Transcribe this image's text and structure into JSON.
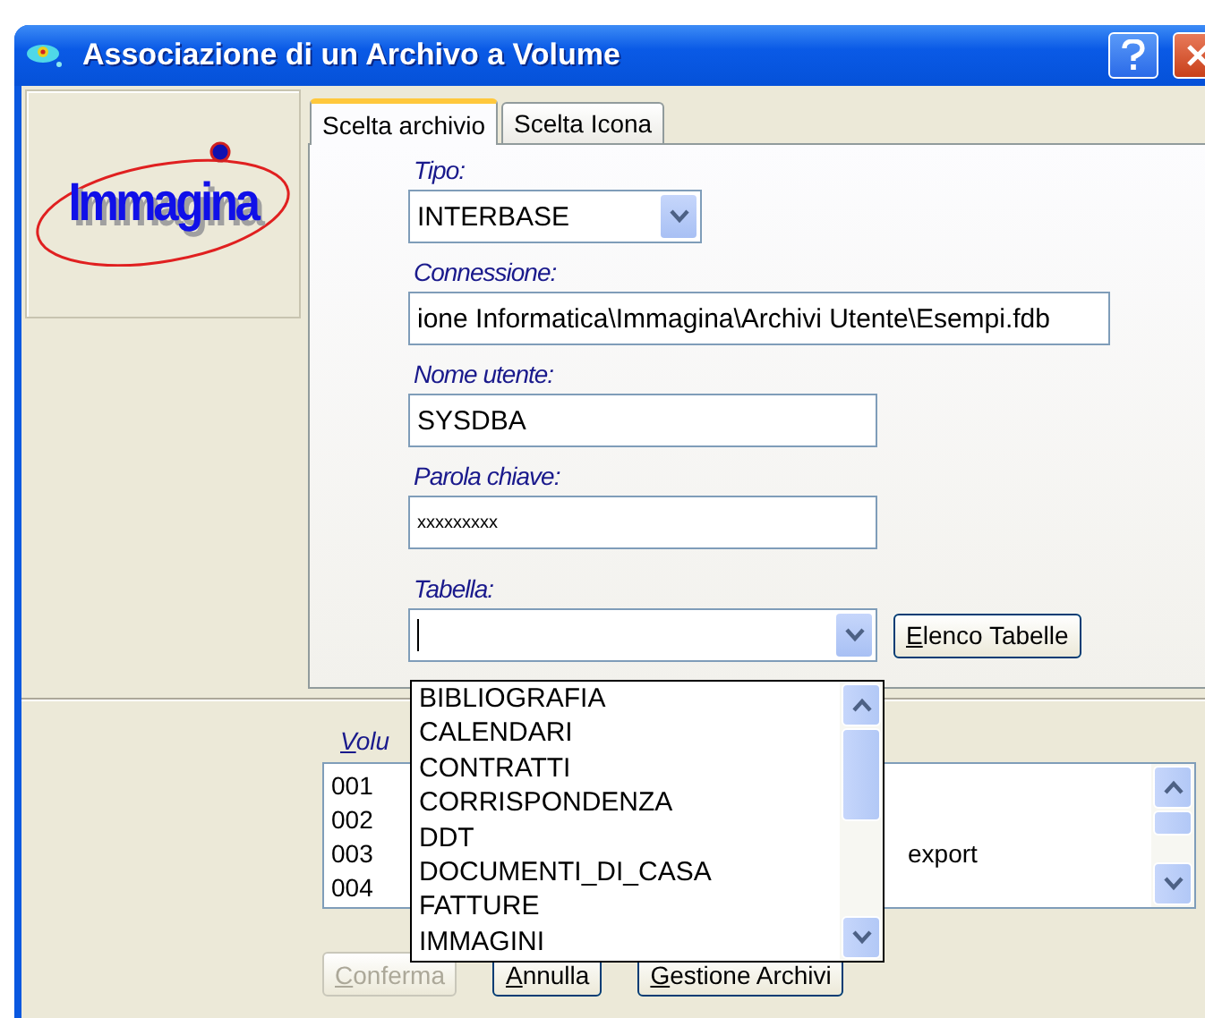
{
  "window": {
    "title": "Associazione di un Archivo a Volume"
  },
  "logo": {
    "text": "Immagina"
  },
  "tabs": [
    {
      "label": "Scelta archivio",
      "selected": true
    },
    {
      "label": "Scelta Icona",
      "selected": false
    }
  ],
  "fields": [
    {
      "kind": "combo",
      "label": "Tipo:",
      "value": "INTERBASE"
    },
    {
      "kind": "path",
      "label": "Connessione:",
      "value": "ione Informatica\\Immagina\\Archivi Utente\\Esempi.fdb"
    },
    {
      "kind": "text",
      "label": "Nome utente:",
      "value": "SYSDBA"
    },
    {
      "kind": "password",
      "label": "Parola chiave:",
      "value": "xxxxxxxxx"
    },
    {
      "kind": "table-combo",
      "label": "Tabella:",
      "button": "Elenco Tabelle"
    }
  ],
  "table_dropdown": {
    "items": [
      "BIBLIOGRAFIA",
      "CALENDARI",
      "CONTRATTI",
      "CORRISPONDENZA",
      "DDT",
      "DOCUMENTI_DI_CASA",
      "FATTURE",
      "IMMAGINI"
    ]
  },
  "volumes": {
    "label": "Volu",
    "rows": [
      {
        "code": "001"
      },
      {
        "code": "002"
      },
      {
        "code": "003",
        "column_2": "export"
      },
      {
        "code": "004"
      }
    ]
  },
  "buttons": [
    {
      "label": "Conferma",
      "disabled": true
    },
    {
      "label": "Annulla",
      "disabled": false
    },
    {
      "label": "Gestione Archivi",
      "disabled": false
    }
  ]
}
